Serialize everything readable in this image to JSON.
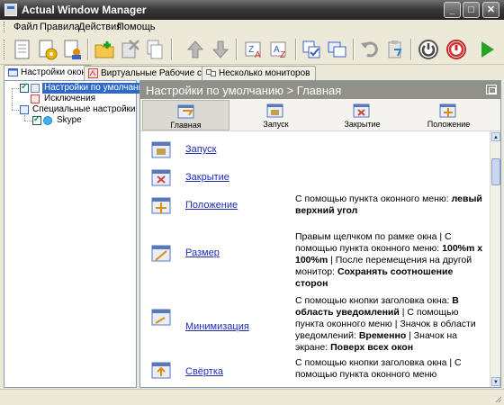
{
  "window": {
    "title": "Actual Window Manager",
    "icon": "app-icon",
    "controls": {
      "minimize": "_",
      "maximize": "□",
      "close": "✕"
    }
  },
  "menu": {
    "items": [
      "Файл",
      "Правила",
      "Действия",
      "Помощь"
    ]
  },
  "toolbar": {
    "buttons": [
      "new-document-icon",
      "settings-gear-icon",
      "settings-user-icon",
      "folder-add-icon",
      "delete-icon",
      "copy-document-icon",
      "arrow-up-icon",
      "arrow-down-icon",
      "sort-za-icon",
      "sort-az-icon",
      "check-all-icon",
      "window-copy-icon",
      "undo-icon",
      "clipboard-icon",
      "power-icon",
      "stop-icon",
      "play-icon"
    ]
  },
  "tabs": [
    {
      "label": "Настройки окон",
      "active": true
    },
    {
      "label": "Виртуальные Рабочие столы",
      "active": false
    },
    {
      "label": "Несколько мониторов",
      "active": false
    }
  ],
  "tree": {
    "items": [
      {
        "label": "Настройки по умолчанию",
        "checked": true,
        "selected": true
      },
      {
        "label": "Исключения",
        "checked": false,
        "selected": false
      },
      {
        "label": "Специальные настройки",
        "checked": false,
        "selected": false
      },
      {
        "label": "Skype",
        "checked": true,
        "selected": false
      }
    ]
  },
  "panel": {
    "header": "Настройки по умолчанию > Главная",
    "tabs": [
      {
        "label": "Главная",
        "active": true
      },
      {
        "label": "Запуск",
        "active": false
      },
      {
        "label": "Закрытие",
        "active": false
      },
      {
        "label": "Положение",
        "active": false
      }
    ],
    "more_arrow": "▸"
  },
  "list": {
    "items": [
      {
        "link": "Запуск",
        "icon": "launch-icon",
        "desc": ""
      },
      {
        "link": "Закрытие",
        "icon": "close-window-icon",
        "desc": ""
      },
      {
        "link": "Положение",
        "icon": "position-icon",
        "desc_parts": [
          "С помощью пункта оконного меню: ",
          "левый верхний угол"
        ]
      },
      {
        "link": "Размер",
        "icon": "size-icon",
        "desc_parts": [
          "Правым щелчком по рамке окна | С помощью пункта оконного меню: ",
          "100%m x 100%m",
          " | После перемещения на другой монитор: ",
          "Сохранять соотношение сторон"
        ]
      },
      {
        "link": "Минимизация",
        "icon": "minimize-icon",
        "desc_parts": [
          "С помощью кнопки заголовка окна: ",
          "В область уведомлений",
          " | С помощью пункта оконного меню | Значок в области уведомлений: ",
          "Временно",
          " | Значок на экране: ",
          "Поверх всех окон"
        ]
      },
      {
        "link": "Свёртка",
        "icon": "rollup-icon",
        "desc_parts": [
          "С помощью кнопки заголовка окна | С помощью пункта оконного меню"
        ]
      }
    ]
  },
  "colors": {
    "titlebar": "#3a3a3a",
    "selection": "#316ac5",
    "link": "#1f2bb8",
    "panel_header": "#919189"
  }
}
